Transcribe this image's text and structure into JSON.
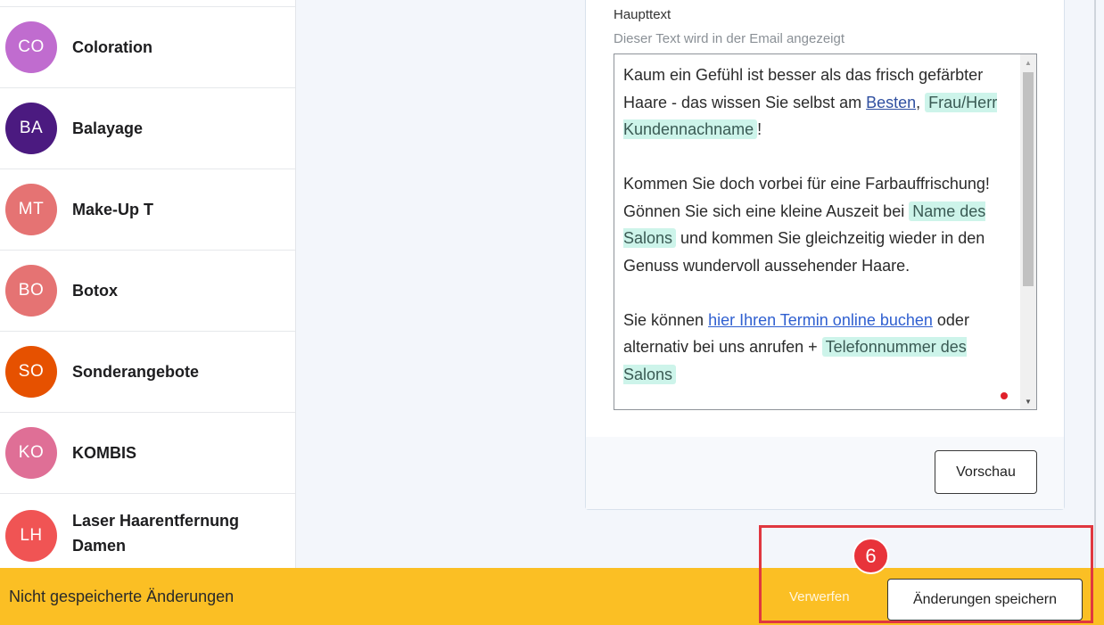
{
  "sidebar": {
    "items": [
      {
        "initials": "CO",
        "label": "Coloration",
        "color": "#c06ccf"
      },
      {
        "initials": "BA",
        "label": "Balayage",
        "color": "#4b1a80"
      },
      {
        "initials": "MT",
        "label": "Make-Up T",
        "color": "#e57373"
      },
      {
        "initials": "BO",
        "label": "Botox",
        "color": "#e57373"
      },
      {
        "initials": "SO",
        "label": "Sonderangebote",
        "color": "#e65100"
      },
      {
        "initials": "KO",
        "label": "KOMBIS",
        "color": "#df6f96"
      },
      {
        "initials": "LH",
        "label": "Laser Haarentfernung Damen",
        "color": "#f05454"
      }
    ]
  },
  "editor": {
    "label": "Haupttext",
    "hint": "Dieser Text wird in der Email angezeigt",
    "p1_a": "Kaum ein Gefühl ist besser als das frisch gefärbter Haare - das wissen Sie selbst am ",
    "p1_link": "Besten",
    "p1_b": ", ",
    "p1_tag": "Frau/Herr Kundennachname",
    "p1_c": "!",
    "p2_a": "Kommen Sie doch vorbei für eine Farbauffrischung! Gönnen Sie sich eine kleine Auszeit bei ",
    "p2_tag": "Name des Salons",
    "p2_b": " und kommen Sie gleichzeitig wieder in den Genuss wundervoll aussehender Haare.",
    "p3_a": "Sie können ",
    "p3_link": "hier Ihren Termin online buchen",
    "p3_b": " oder alternativ bei uns anrufen + ",
    "p3_tag": "Telefonnummer des Salons"
  },
  "buttons": {
    "preview": "Vorschau",
    "discard": "Verwerfen",
    "save": "Änderungen speichern"
  },
  "status": {
    "unsaved": "Nicht gespeicherte Änderungen"
  },
  "annotation": {
    "step": "6"
  },
  "colors": {
    "bottom_bar": "#fbbf24",
    "tag_bg": "#cdf4ea",
    "annotation": "#e0373f"
  }
}
